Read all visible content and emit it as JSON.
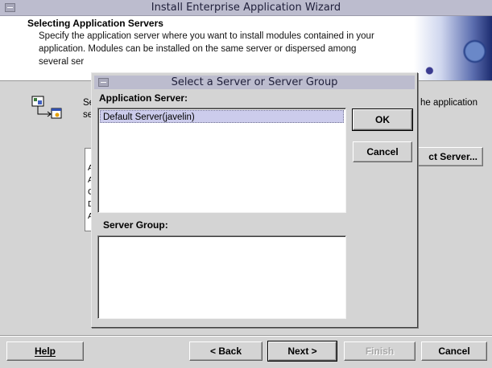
{
  "wizard": {
    "title": "Install Enterprise Application Wizard",
    "section_title": "Selecting Application Servers",
    "description_lines": [
      "Specify the application server where you want to install modules contained in your",
      "application. Modules can be installed on the same server or dispersed among",
      "several ser"
    ],
    "body_text_left": [
      "Se",
      "se"
    ],
    "body_text_right": "he application",
    "list_letters": [
      "A",
      "A",
      "C",
      "D",
      "A"
    ],
    "select_server_label": "ct Server...",
    "buttons": {
      "help": "Help",
      "back": "< Back",
      "next": "Next >",
      "finish": "Finish",
      "cancel": "Cancel"
    }
  },
  "dialog": {
    "title": "Select a Server or Server Group",
    "app_server_label": "Application Server:",
    "app_servers": [
      "Default Server(javelin)"
    ],
    "server_group_label": "Server Group:",
    "ok_label": "OK",
    "cancel_label": "Cancel"
  }
}
